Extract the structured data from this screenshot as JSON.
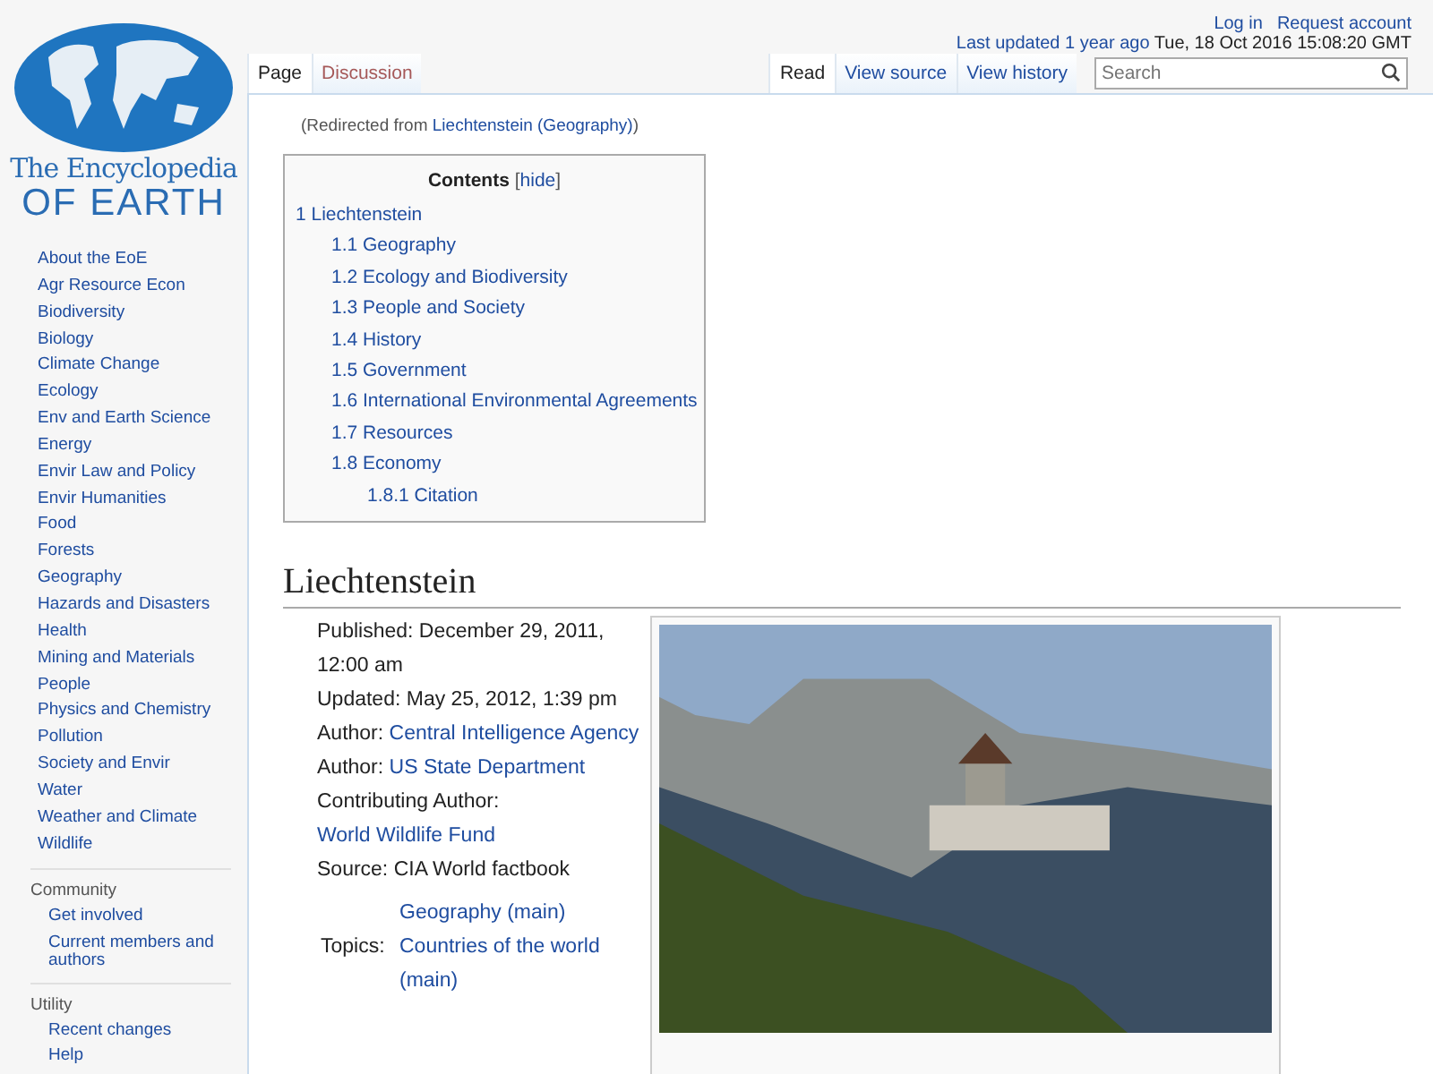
{
  "logo": {
    "line1": "The Encyclopedia",
    "line2": "OF EARTH"
  },
  "personal": [
    "Log in",
    "Request account"
  ],
  "last_updated": {
    "link": "Last updated 1 year ago",
    "text": "Tue, 18 Oct 2016 15:08:20 GMT"
  },
  "tabs_left": [
    {
      "label": "Page",
      "selected": true,
      "missing": false
    },
    {
      "label": "Discussion",
      "selected": false,
      "missing": true
    }
  ],
  "tabs_right": [
    {
      "label": "Read",
      "selected": true
    },
    {
      "label": "View source",
      "selected": false
    },
    {
      "label": "View history",
      "selected": false
    }
  ],
  "search": {
    "placeholder": "Search"
  },
  "sidebar": {
    "items": [
      "About the EoE",
      "Agr Resource Econ",
      "Biodiversity",
      "Biology",
      "Climate Change",
      "Ecology",
      "Env and Earth Science",
      "Energy",
      "Envir Law and Policy",
      "Envir Humanities",
      "Food",
      "Forests",
      "Geography",
      "Hazards and Disasters",
      "Health",
      "Mining and Materials",
      "People",
      "Physics and Chemistry",
      "Pollution",
      "Society and Envir",
      "Water",
      "Weather and Climate",
      "Wildlife"
    ],
    "portals": [
      {
        "heading": "Community",
        "items": [
          "Get involved",
          "Current members and authors"
        ]
      },
      {
        "heading": "Utility",
        "items": [
          "Recent changes",
          "Help"
        ]
      }
    ]
  },
  "redirect": {
    "prefix": "(Redirected from ",
    "link": "Liechtenstein (Geography)",
    "suffix": ")"
  },
  "toc": {
    "title": "Contents",
    "open": "[",
    "toggle": "hide",
    "close": "]",
    "items": [
      {
        "label": "1 Liechtenstein",
        "children": [
          {
            "label": "1.1 Geography"
          },
          {
            "label": "1.2 Ecology and Biodiversity"
          },
          {
            "label": "1.3 People and Society"
          },
          {
            "label": "1.4 History"
          },
          {
            "label": "1.5 Government"
          },
          {
            "label": "1.6 International Environmental Agreements"
          },
          {
            "label": "1.7 Resources"
          },
          {
            "label": "1.8 Economy",
            "children": [
              {
                "label": "1.8.1 Citation"
              }
            ]
          }
        ]
      }
    ]
  },
  "heading": "Liechtenstein",
  "meta": [
    {
      "label": "Published:",
      "value": "December 29, 2011, 12:00 am"
    },
    {
      "label": "Updated:",
      "value": "May 25, 2012, 1:39 pm"
    },
    {
      "label": "Author:",
      "link": "Central Intelligence Agency"
    },
    {
      "label": "Author:",
      "link": "US State Department"
    },
    {
      "label": "Contributing Author:",
      "link": "World Wildlife Fund"
    },
    {
      "label": "Source:",
      "value": "CIA World factbook"
    }
  ],
  "topics": {
    "label": "Topics:",
    "links": [
      "Geography (main)",
      "Countries of the world (main)"
    ]
  }
}
